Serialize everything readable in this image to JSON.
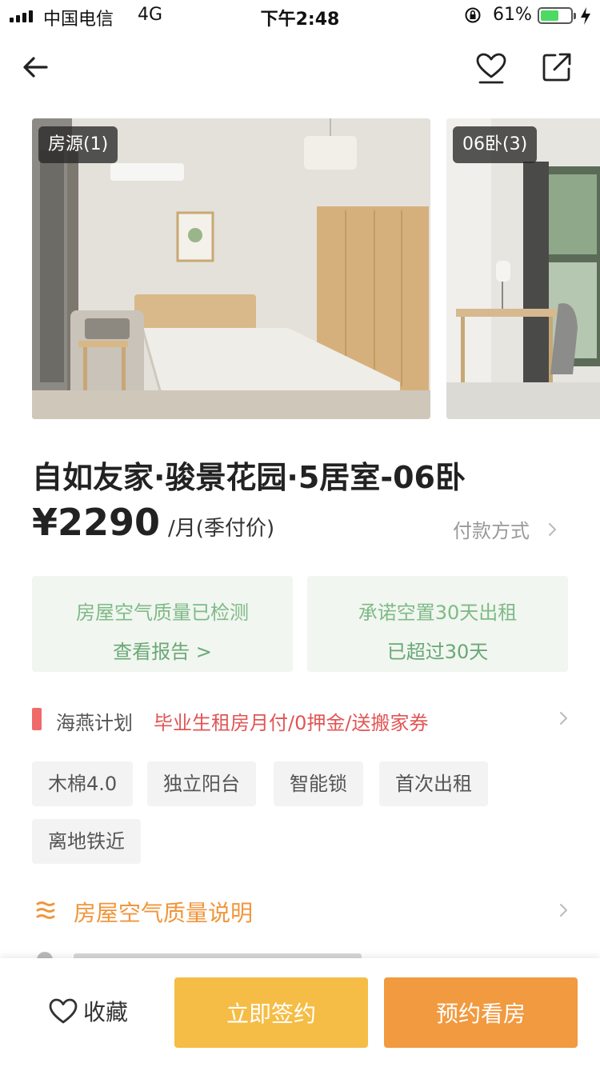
{
  "status_bar": {
    "carrier": "中国电信",
    "network": "4G",
    "time": "下午2:48",
    "battery": "61%",
    "battery_level": 0.61
  },
  "nav": {
    "icons": [
      "back-arrow-icon",
      "heart-icon",
      "share-icon"
    ]
  },
  "gallery": {
    "photos": [
      {
        "tag": "房源(1)"
      },
      {
        "tag": "06卧(3)"
      }
    ]
  },
  "listing": {
    "title": "自如友家·骏景花园·5居室-06卧",
    "price": "¥2290",
    "price_unit": "/月(季付价)",
    "payment_link": "付款方式"
  },
  "cards": [
    {
      "line1": "房屋空气质量已检测",
      "line2": "查看报告 >"
    },
    {
      "line1": "承诺空置30天出租",
      "line2": "已超过30天"
    }
  ],
  "promo": {
    "name": "海燕计划",
    "text": "毕业生租房月付/0押金/送搬家券"
  },
  "tags": [
    "木棉4.0",
    "独立阳台",
    "智能锁",
    "首次出租",
    "离地铁近"
  ],
  "air_quality": {
    "label": "房屋空气质量说明"
  },
  "bottom_bar": {
    "collect_label": "收藏",
    "sign_label": "立即签约",
    "visit_label": "预约看房"
  },
  "colors": {
    "green_text": "#7fba87",
    "promo_red": "#e25555",
    "air_orange": "#f0963c",
    "sign_button": "#f5bd45",
    "visit_button": "#f19a3f"
  }
}
